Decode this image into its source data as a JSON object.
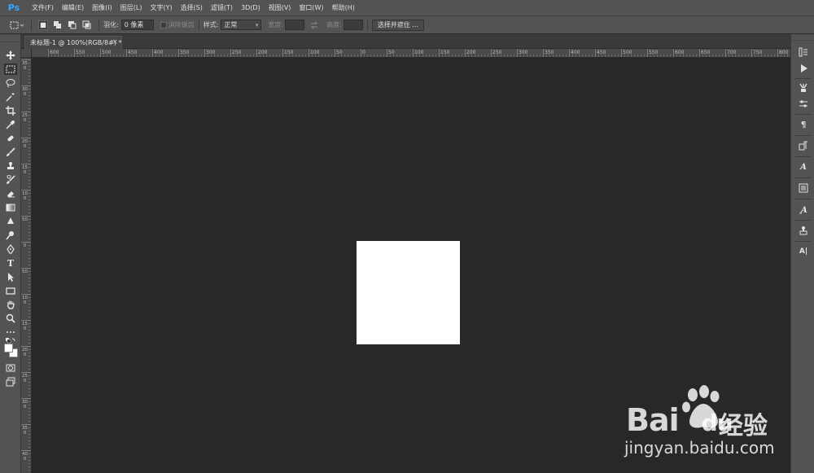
{
  "app": {
    "logo": "Ps",
    "accent": "#31a8ff"
  },
  "menu": [
    "文件(F)",
    "编辑(E)",
    "图像(I)",
    "图层(L)",
    "文字(Y)",
    "选择(S)",
    "滤镜(T)",
    "3D(D)",
    "视图(V)",
    "窗口(W)",
    "帮助(H)"
  ],
  "options": {
    "feather_label": "羽化:",
    "feather_value": "0 像素",
    "antialias_label": "消除锯齿",
    "style_label": "样式:",
    "style_value": "正常",
    "width_label": "宽度:",
    "height_label": "高度:",
    "select_mask_button": "选择并遮住 ..."
  },
  "document": {
    "tab_title": "未标题-1 @ 100%(RGB/8#) *",
    "canvas_color": "#ffffff"
  },
  "ruler_h": [
    "600",
    "550",
    "500",
    "450",
    "400",
    "350",
    "300",
    "250",
    "200",
    "150",
    "100",
    "50",
    "0",
    "50",
    "100",
    "150",
    "200",
    "250",
    "300",
    "350",
    "400",
    "450",
    "500",
    "550",
    "600",
    "650",
    "700",
    "750",
    "800"
  ],
  "ruler_v": [
    "3 5 0",
    "3 0 0",
    "2 5 0",
    "2 0 0",
    "1 5 0",
    "1 0 0",
    "5 0",
    "0",
    "5 0",
    "1 0 0",
    "1 5 0",
    "2 0 0",
    "2 5 0",
    "3 0 0",
    "3 5 0",
    "4 0 0"
  ],
  "tools": [
    "move-tool-icon",
    "marquee-tool-icon",
    "lasso-tool-icon",
    "magic-wand-tool-icon",
    "crop-tool-icon",
    "eyedropper-tool-icon",
    "healing-brush-tool-icon",
    "brush-tool-icon",
    "clone-stamp-tool-icon",
    "history-brush-tool-icon",
    "eraser-tool-icon",
    "gradient-tool-icon",
    "blur-tool-icon",
    "dodge-tool-icon",
    "pen-tool-icon",
    "type-tool-icon",
    "path-selection-tool-icon",
    "rectangle-tool-icon",
    "hand-tool-icon",
    "zoom-tool-icon",
    "more-tools-icon"
  ],
  "type_tool_glyph": "T",
  "dock": {
    "paragraph_glyph": "¶",
    "character_glyph": "A",
    "glyphs_glyph": "A|"
  },
  "watermark": {
    "logo_text": "Bai",
    "logo_du": "du",
    "cn_text": "经验",
    "url": "jingyan.baidu.com"
  }
}
